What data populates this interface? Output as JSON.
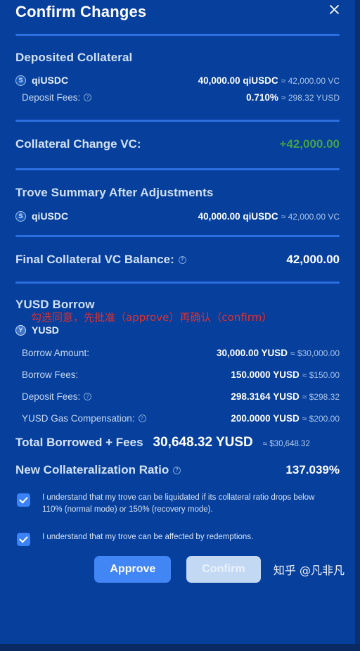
{
  "header": {
    "title": "Confirm Changes",
    "close_icon": "close-icon"
  },
  "deposited_collateral": {
    "section_title": "Deposited Collateral",
    "token": {
      "icon": "qiusdc-coin-icon",
      "name": "qiUSDC",
      "amount": "40,000.00 qiUSDC",
      "approx": "≈ 42,000.00 VC"
    },
    "deposit_fees": {
      "label": "Deposit Fees:",
      "info_icon": "info-icon",
      "value": "0.710%",
      "approx": "≈ 298.32 YUSD"
    }
  },
  "collateral_change": {
    "label": "Collateral Change VC:",
    "value": "+42,000.00",
    "value_color": "#46a049"
  },
  "trove_summary": {
    "section_title": "Trove Summary After Adjustments",
    "token": {
      "icon": "qiusdc-coin-icon",
      "name": "qiUSDC",
      "amount": "40,000.00 qiUSDC",
      "approx": "≈ 42,000.00 VC"
    }
  },
  "final_balance": {
    "label": "Final Collateral VC Balance:",
    "info_icon": "info-icon",
    "value": "42,000.00"
  },
  "yusd_borrow": {
    "section_title": "YUSD Borrow",
    "annotation": "勾选同意，先批准（approve）再确认（confirm）",
    "annotation_color": "#e03030",
    "token": {
      "icon": "yusd-coin-icon",
      "name": "YUSD"
    },
    "rows": [
      {
        "label": "Borrow Amount:",
        "info": false,
        "value": "30,000.00 YUSD",
        "approx": "≈ $30,000.00"
      },
      {
        "label": "Borrow Fees:",
        "info": false,
        "value": "150.0000 YUSD",
        "approx": "≈ $150.00"
      },
      {
        "label": "Deposit Fees:",
        "info": true,
        "value": "298.3164 YUSD",
        "approx": "≈ $298.32"
      },
      {
        "label": "YUSD Gas Compensation:",
        "info": true,
        "value": "200.0000 YUSD",
        "approx": "≈ $200.00"
      }
    ]
  },
  "total_borrowed": {
    "label": "Total Borrowed + Fees",
    "value": "30,648.32 YUSD",
    "approx": "≈ $30,648.32"
  },
  "new_ratio": {
    "label": "New Collateralization Ratio",
    "info_icon": "info-icon",
    "value": "137.039%"
  },
  "acknowledgements": [
    {
      "checked": true,
      "text": "I understand that my trove can be liquidated if its collateral ratio drops below 110% (normal mode) or 150% (recovery mode)."
    },
    {
      "checked": true,
      "text": "I understand that my trove can be affected by redemptions."
    }
  ],
  "footer": {
    "approve_label": "Approve",
    "confirm_label": "Confirm",
    "watermark": "知乎 @凡非凡"
  },
  "theme": {
    "background": "#063f9c",
    "divider": "#2b6fe0",
    "accent_button": "#4285f4",
    "disabled_button": "#c3d8f2",
    "checkbox": "#3b82f6"
  }
}
